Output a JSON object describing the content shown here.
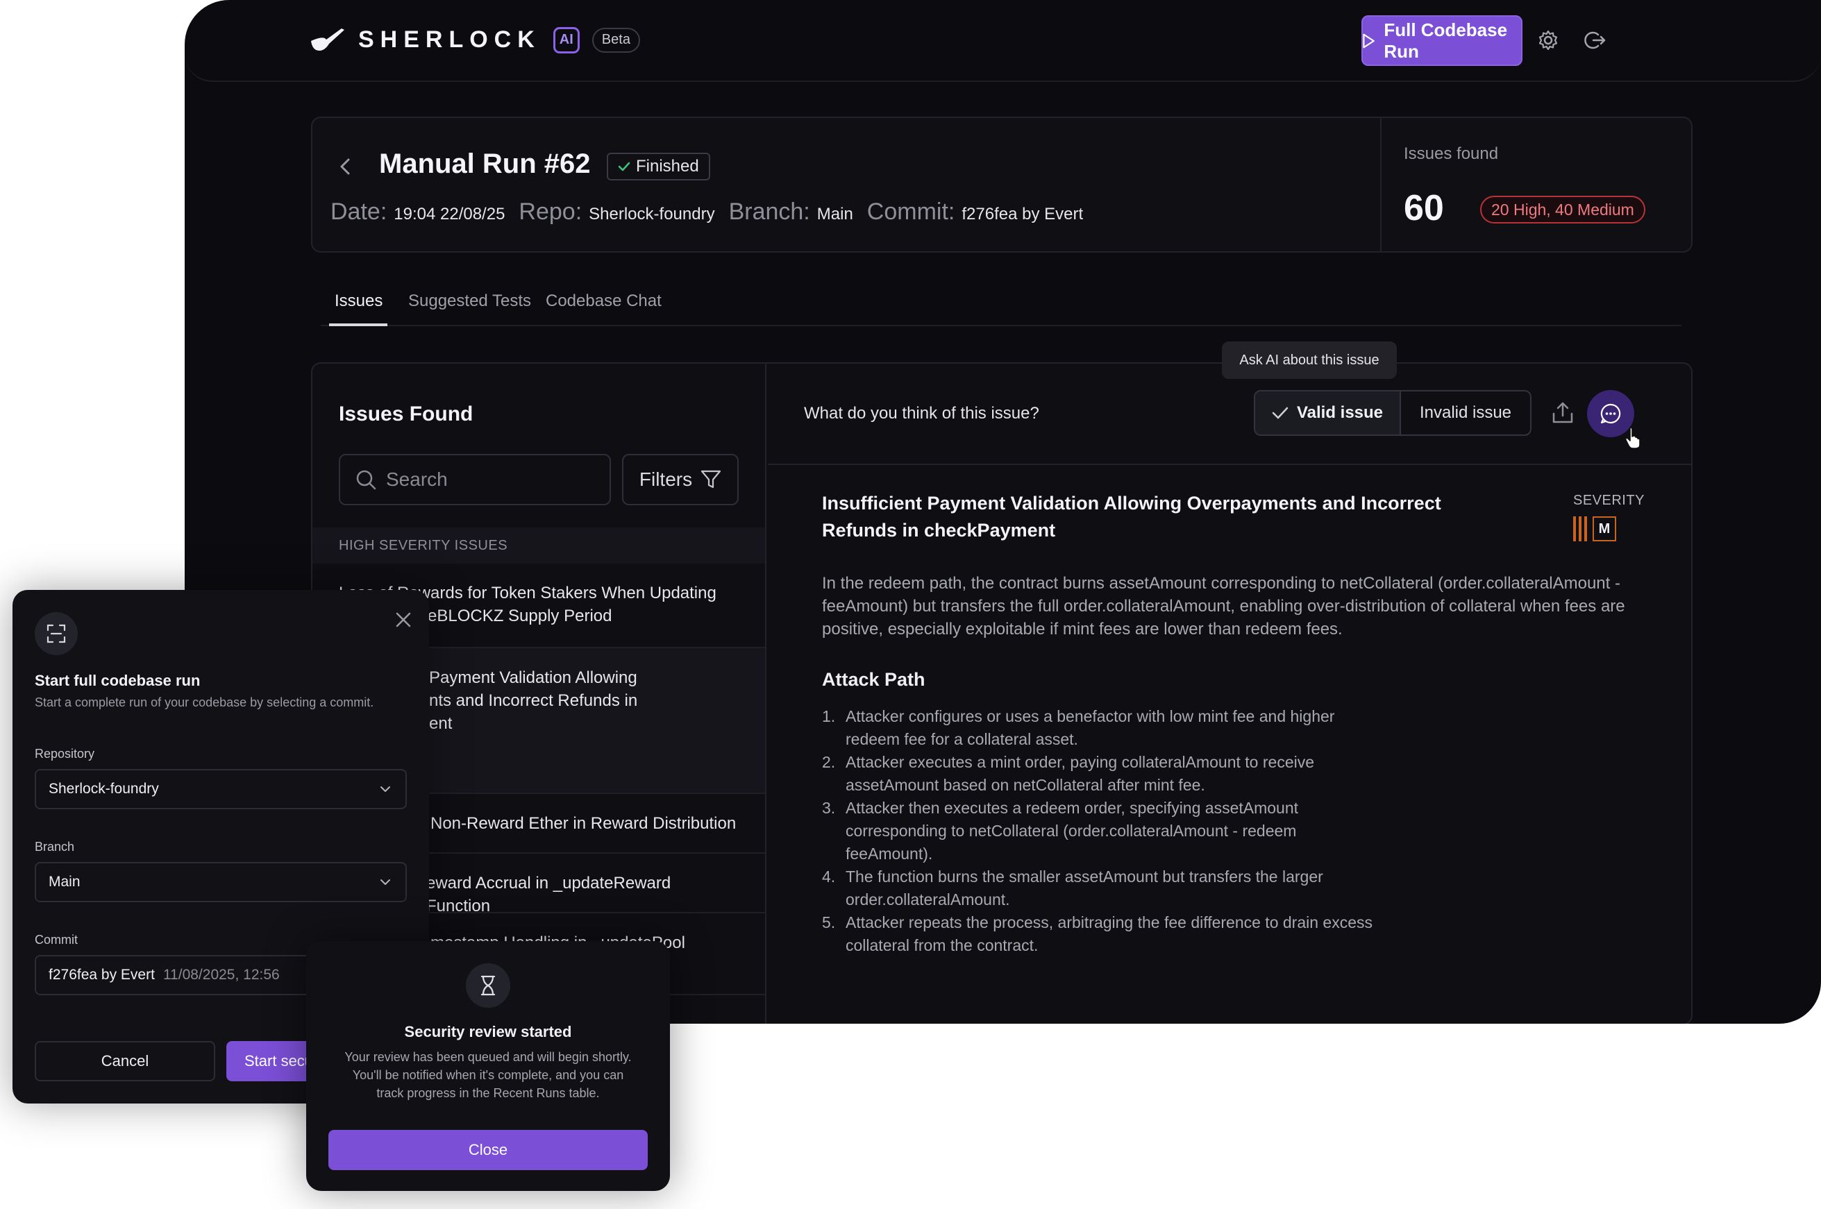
{
  "header": {
    "brand": "SHERLOCK",
    "ai_badge": "AI",
    "beta": "Beta",
    "run_button": "Full Codebase Run"
  },
  "run": {
    "title": "Manual Run #62",
    "status": "Finished",
    "date_label": "Date:",
    "date": "19:04 22/08/25",
    "repo_label": "Repo:",
    "repo": "Sherlock-foundry",
    "branch_label": "Branch:",
    "branch": "Main",
    "commit_label": "Commit:",
    "commit": "f276fea by Evert",
    "issues_found_label": "Issues found",
    "issues_count": "60",
    "severity_summary": "20 High, 40 Medium"
  },
  "tabs": [
    {
      "label": "Issues",
      "active": true
    },
    {
      "label": "Suggested Tests",
      "active": false
    },
    {
      "label": "Codebase Chat",
      "active": false
    }
  ],
  "issues_panel": {
    "title": "Issues Found",
    "search_placeholder": "Search",
    "filters": "Filters",
    "section_high": "HIGH SEVERITY ISSUES",
    "items": [
      {
        "line1": "Loss of Rewards for Token Stakers When Updating",
        "line2": "eBLOCKZ Supply Period"
      },
      {
        "line1": "Payment Validation Allowing",
        "line2": "nts and Incorrect Refunds in",
        "line3": "ent"
      },
      {
        "line1": "Non-Reward Ether in Reward Distribution"
      },
      {
        "line1": "eward Accrual in _updateReward Function"
      },
      {
        "line1": "mestamp Handling in _updatePool"
      }
    ]
  },
  "detail": {
    "feedback_question": "What do you think  of this issue?",
    "valid": "Valid issue",
    "invalid": "Invalid issue",
    "tooltip": "Ask AI about this issue",
    "heading_line1": "Insufficient Payment Validation Allowing Overpayments and Incorrect",
    "heading_line2": "Refunds in checkPayment",
    "severity_label": "SEVERITY",
    "severity_value": "M",
    "description": "In the redeem path, the contract burns assetAmount corresponding to  netCollateral (order.collateralAmount - feeAmount) but transfers the  full order.collateralAmount, enabling over-distribution of collateral  when fees are positive, especially exploitable if mint fees are lower  than redeem fees.",
    "attack_title": "Attack Path",
    "attack_steps": [
      {
        "num": "1.",
        "text": "Attacker configures or uses a benefactor with low mint fee and higher redeem fee for a collateral asset."
      },
      {
        "num": "2.",
        "text": "Attacker executes a mint order, paying collateralAmount to receive assetAmount based on netCollateral after mint fee."
      },
      {
        "num": "3.",
        "text": "Attacker then executes a redeem order, specifying assetAmount corresponding to netCollateral (order.collateralAmount - redeem feeAmount)."
      },
      {
        "num": "4.",
        "text": "The function burns the smaller assetAmount but transfers the larger order.collateralAmount."
      },
      {
        "num": "5.",
        "text": "Attacker repeats the process, arbitraging the fee difference to drain excess collateral from the contract."
      }
    ]
  },
  "commit_dialog": {
    "title": "Start full codebase run",
    "subtitle": "Start a complete run of your codebase by selecting a commit.",
    "repository_label": "Repository",
    "repository_value": "Sherlock-foundry",
    "branch_label": "Branch",
    "branch_value": "Main",
    "commit_label": "Commit",
    "commit_value": "f276fea by Evert",
    "commit_time": "11/08/2025, 12:56",
    "cancel": "Cancel",
    "start": "Start security review"
  },
  "review_dialog": {
    "title": "Security review started",
    "body_line1": "Your review has been queued and will begin shortly.",
    "body_line2": "You'll be notified when it's complete, and you can",
    "body_line3": "track progress in the Recent Runs table.",
    "close": "Close"
  },
  "colors": {
    "accent": "#7b4fd6",
    "background": "#0c0c10",
    "high_severity": "#ee7b80",
    "medium_severity": "#c8641f"
  }
}
